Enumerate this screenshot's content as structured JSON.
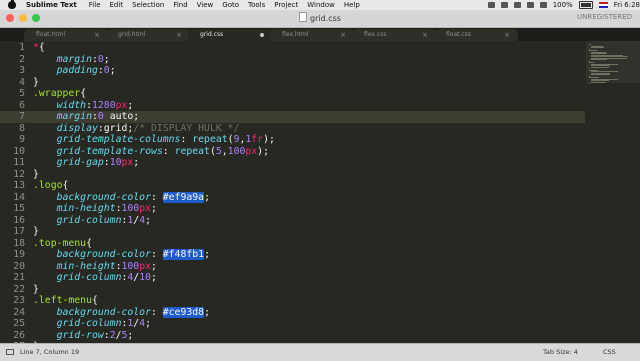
{
  "menubar": {
    "app_name": "Sublime Text",
    "items": [
      "File",
      "Edit",
      "Selection",
      "Find",
      "View",
      "Goto",
      "Tools",
      "Project",
      "Window",
      "Help"
    ],
    "battery": "100%",
    "clock": "Fri 6:28"
  },
  "window": {
    "title": "grid.css",
    "unregistered": "UNREGISTERED",
    "traffic_lights": [
      "#fc605b",
      "#fdbc40",
      "#34c84a"
    ]
  },
  "tabs": [
    {
      "label": "float.html",
      "active": false
    },
    {
      "label": "grid.html",
      "active": false
    },
    {
      "label": "grid.css",
      "active": true
    },
    {
      "label": "flex.html",
      "active": false
    },
    {
      "label": "flex.css",
      "active": false
    },
    {
      "label": "float.css",
      "active": false
    }
  ],
  "editor": {
    "current_line": 7,
    "lines": [
      [
        {
          "t": "*",
          "c": "t-star"
        },
        {
          "t": "{",
          "c": "t-kw"
        }
      ],
      [
        {
          "t": "    ",
          "c": ""
        },
        {
          "t": "margin",
          "c": "t-prop"
        },
        {
          "t": ":",
          "c": ""
        },
        {
          "t": "0",
          "c": "t-num"
        },
        {
          "t": ";",
          "c": ""
        }
      ],
      [
        {
          "t": "    ",
          "c": ""
        },
        {
          "t": "padding",
          "c": "t-prop"
        },
        {
          "t": ":",
          "c": ""
        },
        {
          "t": "0",
          "c": "t-num"
        },
        {
          "t": ";",
          "c": ""
        }
      ],
      [
        {
          "t": "}",
          "c": ""
        }
      ],
      [
        {
          "t": ".wrapper",
          "c": "t-sel"
        },
        {
          "t": "{",
          "c": ""
        }
      ],
      [
        {
          "t": "    ",
          "c": ""
        },
        {
          "t": "width",
          "c": "t-prop"
        },
        {
          "t": ":",
          "c": ""
        },
        {
          "t": "1280",
          "c": "t-num"
        },
        {
          "t": "px",
          "c": "t-unit"
        },
        {
          "t": ";",
          "c": ""
        }
      ],
      [
        {
          "t": "    ",
          "c": ""
        },
        {
          "t": "margin",
          "c": "t-prop"
        },
        {
          "t": ":",
          "c": ""
        },
        {
          "t": "0",
          "c": "t-num"
        },
        {
          "t": " auto;",
          "c": ""
        }
      ],
      [
        {
          "t": "    ",
          "c": ""
        },
        {
          "t": "display",
          "c": "t-prop"
        },
        {
          "t": ":grid;",
          "c": ""
        },
        {
          "t": "/* DISPLAY HULK */",
          "c": "t-com"
        }
      ],
      [
        {
          "t": "    ",
          "c": ""
        },
        {
          "t": "grid-template-columns",
          "c": "t-prop"
        },
        {
          "t": ": ",
          "c": ""
        },
        {
          "t": "repeat",
          "c": "t-fn"
        },
        {
          "t": "(",
          "c": ""
        },
        {
          "t": "9",
          "c": "t-num"
        },
        {
          "t": ",",
          "c": ""
        },
        {
          "t": "1",
          "c": "t-num"
        },
        {
          "t": "fr",
          "c": "t-unit"
        },
        {
          "t": ");",
          "c": ""
        }
      ],
      [
        {
          "t": "    ",
          "c": ""
        },
        {
          "t": "grid-template-rows",
          "c": "t-prop"
        },
        {
          "t": ": ",
          "c": ""
        },
        {
          "t": "repeat",
          "c": "t-fn"
        },
        {
          "t": "(",
          "c": ""
        },
        {
          "t": "5",
          "c": "t-num"
        },
        {
          "t": ",",
          "c": ""
        },
        {
          "t": "100",
          "c": "t-num"
        },
        {
          "t": "px",
          "c": "t-unit"
        },
        {
          "t": ");",
          "c": ""
        }
      ],
      [
        {
          "t": "    ",
          "c": ""
        },
        {
          "t": "grid-gap",
          "c": "t-prop"
        },
        {
          "t": ":",
          "c": ""
        },
        {
          "t": "10",
          "c": "t-num"
        },
        {
          "t": "px",
          "c": "t-unit"
        },
        {
          "t": ";",
          "c": ""
        }
      ],
      [
        {
          "t": "}",
          "c": ""
        }
      ],
      [
        {
          "t": ".logo",
          "c": "t-sel"
        },
        {
          "t": "{",
          "c": ""
        }
      ],
      [
        {
          "t": "    ",
          "c": ""
        },
        {
          "t": "background-color",
          "c": "t-prop"
        },
        {
          "t": ": ",
          "c": ""
        },
        {
          "t": "#ef9a9a",
          "c": "t-hex"
        },
        {
          "t": ";",
          "c": ""
        }
      ],
      [
        {
          "t": "    ",
          "c": ""
        },
        {
          "t": "min-height",
          "c": "t-prop"
        },
        {
          "t": ":",
          "c": ""
        },
        {
          "t": "100",
          "c": "t-num"
        },
        {
          "t": "px",
          "c": "t-unit"
        },
        {
          "t": ";",
          "c": ""
        }
      ],
      [
        {
          "t": "    ",
          "c": ""
        },
        {
          "t": "grid-column",
          "c": "t-prop"
        },
        {
          "t": ":",
          "c": ""
        },
        {
          "t": "1",
          "c": "t-num"
        },
        {
          "t": "/",
          "c": ""
        },
        {
          "t": "4",
          "c": "t-num"
        },
        {
          "t": ";",
          "c": ""
        }
      ],
      [
        {
          "t": "}",
          "c": ""
        }
      ],
      [
        {
          "t": ".top-menu",
          "c": "t-sel"
        },
        {
          "t": "{",
          "c": ""
        }
      ],
      [
        {
          "t": "    ",
          "c": ""
        },
        {
          "t": "background-color",
          "c": "t-prop"
        },
        {
          "t": ": ",
          "c": ""
        },
        {
          "t": "#f48fb1",
          "c": "t-hex"
        },
        {
          "t": ";",
          "c": ""
        }
      ],
      [
        {
          "t": "    ",
          "c": ""
        },
        {
          "t": "min-height",
          "c": "t-prop"
        },
        {
          "t": ":",
          "c": ""
        },
        {
          "t": "100",
          "c": "t-num"
        },
        {
          "t": "px",
          "c": "t-unit"
        },
        {
          "t": ";",
          "c": ""
        }
      ],
      [
        {
          "t": "    ",
          "c": ""
        },
        {
          "t": "grid-column",
          "c": "t-prop"
        },
        {
          "t": ":",
          "c": ""
        },
        {
          "t": "4",
          "c": "t-num"
        },
        {
          "t": "/",
          "c": ""
        },
        {
          "t": "10",
          "c": "t-num"
        },
        {
          "t": ";",
          "c": ""
        }
      ],
      [
        {
          "t": "}",
          "c": ""
        }
      ],
      [
        {
          "t": ".left-menu",
          "c": "t-sel"
        },
        {
          "t": "{",
          "c": ""
        }
      ],
      [
        {
          "t": "    ",
          "c": ""
        },
        {
          "t": "background-color",
          "c": "t-prop"
        },
        {
          "t": ": ",
          "c": ""
        },
        {
          "t": "#ce93d8",
          "c": "t-hex"
        },
        {
          "t": ";",
          "c": ""
        }
      ],
      [
        {
          "t": "    ",
          "c": ""
        },
        {
          "t": "grid-column",
          "c": "t-prop"
        },
        {
          "t": ":",
          "c": ""
        },
        {
          "t": "1",
          "c": "t-num"
        },
        {
          "t": "/",
          "c": ""
        },
        {
          "t": "4",
          "c": "t-num"
        },
        {
          "t": ";",
          "c": ""
        }
      ],
      [
        {
          "t": "    ",
          "c": ""
        },
        {
          "t": "grid-row",
          "c": "t-prop"
        },
        {
          "t": ":",
          "c": ""
        },
        {
          "t": "2",
          "c": "t-num"
        },
        {
          "t": "/",
          "c": ""
        },
        {
          "t": "5",
          "c": "t-num"
        },
        {
          "t": ";",
          "c": ""
        }
      ],
      [
        {
          "t": "}",
          "c": ""
        }
      ]
    ]
  },
  "statusbar": {
    "position": "Line 7, Column 19",
    "tab_size": "Tab Size: 4",
    "syntax": "CSS"
  }
}
